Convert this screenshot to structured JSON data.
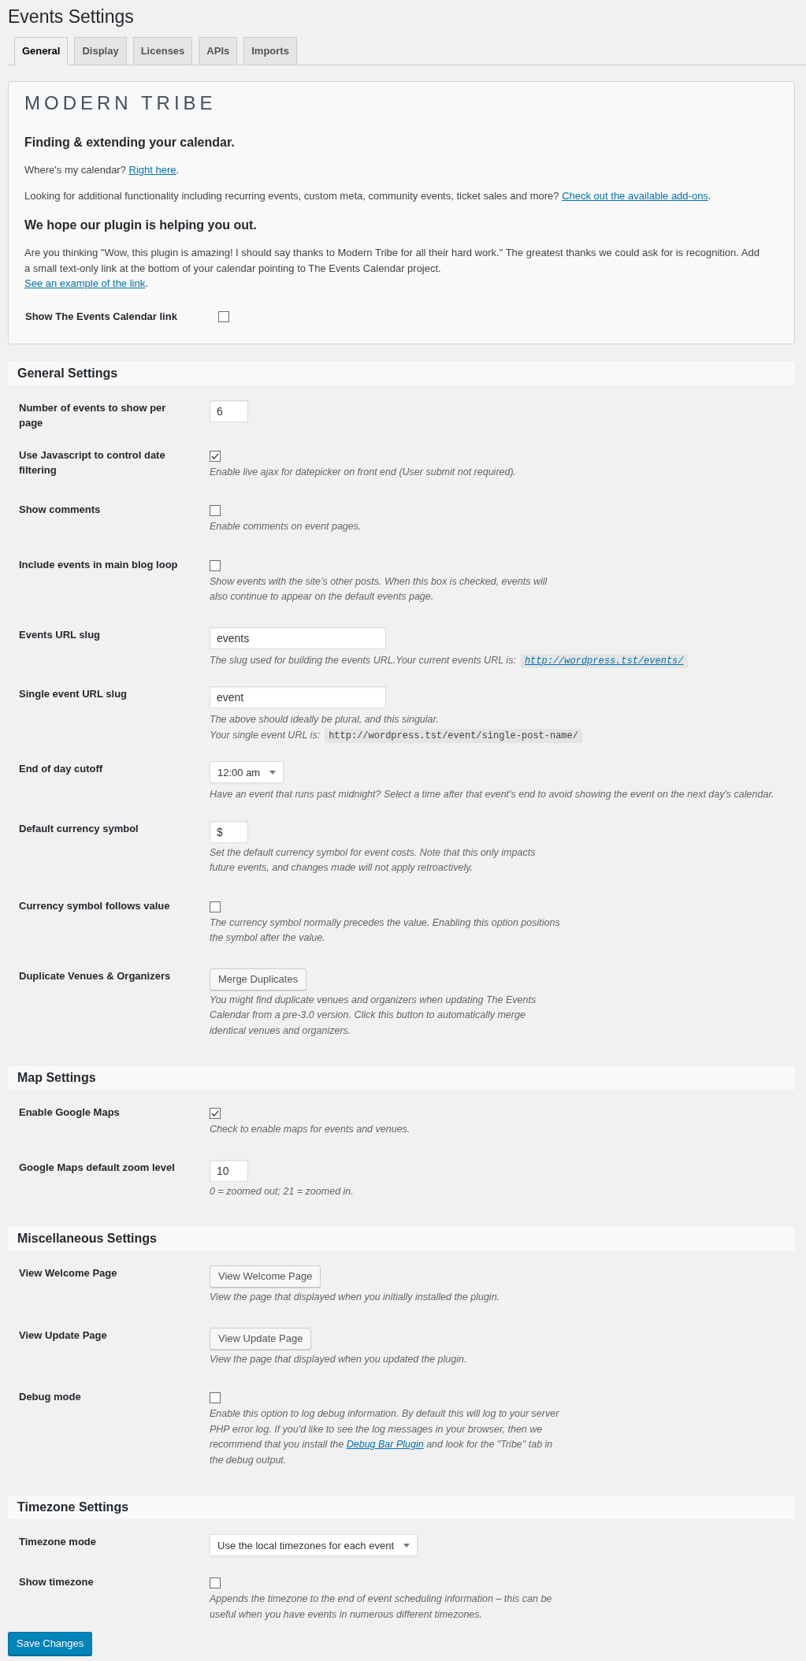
{
  "title": "Events Settings",
  "tabs": [
    {
      "label": "General",
      "selected": true
    },
    {
      "label": "Display",
      "selected": false
    },
    {
      "label": "Licenses",
      "selected": false
    },
    {
      "label": "APIs",
      "selected": false
    },
    {
      "label": "Imports",
      "selected": false
    }
  ],
  "welcome": {
    "logo": "MODERN TRIBE",
    "blocks": [
      {
        "kind": "heading",
        "text": "Finding & extending your calendar."
      },
      {
        "kind": "paragraph",
        "text": "Where's my calendar? ",
        "link": "Right here",
        "after": "."
      },
      {
        "kind": "paragraph",
        "text": "Looking for additional functionality including recurring events, custom meta, community events, ticket sales and more? ",
        "link": "Check out the available add-ons",
        "after": "."
      },
      {
        "kind": "heading",
        "text": "We hope our plugin is helping you out."
      },
      {
        "kind": "paragraph",
        "text": "Are you thinking \"Wow, this plugin is amazing! I should say thanks to Modern Tribe for all their hard work.\" The greatest thanks we could ask for is recognition. Add a small text-only link at the bottom of your calendar pointing to The Events Calendar project.",
        "link_line": {
          "link": "See an example of the link",
          "after": "."
        }
      }
    ],
    "field": {
      "label": "Show The Events Calendar link",
      "kind": "checkbox",
      "checked": false
    }
  },
  "sections": [
    {
      "title": "General Settings",
      "fields": [
        {
          "label": "Number of events to show per page",
          "kind": "short",
          "value": "6"
        },
        {
          "label": "Use Javascript to control date filtering",
          "kind": "checkbox",
          "checked": true,
          "description": "Enable live ajax for datepicker on front end (User submit not required)."
        },
        {
          "label": "Show comments",
          "kind": "checkbox",
          "checked": false,
          "description": "Enable comments on event pages."
        },
        {
          "label": "Include events in main blog loop",
          "kind": "checkbox",
          "checked": false,
          "description": "Show events with the site's other posts. When this box is checked, events will also continue to appear on the default events page."
        },
        {
          "label": "Events URL slug",
          "kind": "text",
          "value": "events",
          "url_label": "The slug used for building the events URL.Your current events URL is:",
          "url": {
            "text": "http://wordpress.tst/events/",
            "linked": true
          }
        },
        {
          "label": "Single event URL slug",
          "kind": "text",
          "value": "event",
          "description": "The above should ideally be plural, and this singular.",
          "url_label": "Your single event URL is:",
          "url": {
            "text": "http://wordpress.tst/event/single-post-name/",
            "linked": false
          }
        },
        {
          "label": "End of day cutoff",
          "kind": "select",
          "value": "12:00 am",
          "description": "Have an event that runs past midnight? Select a time after that event's end to avoid showing the event on the next day's calendar."
        },
        {
          "label": "Default currency symbol",
          "kind": "short",
          "value": "$",
          "description": "Set the default currency symbol for event costs. Note that this only impacts future events, and changes made will not apply retroactively."
        },
        {
          "label": "Currency symbol follows value",
          "kind": "checkbox",
          "checked": false,
          "description": "The currency symbol normally precedes the value. Enabling this option positions the symbol after the value."
        },
        {
          "label": "Duplicate Venues & Organizers",
          "kind": "button",
          "button": "Merge Duplicates",
          "description": "You might find duplicate venues and organizers when updating The Events Calendar from a pre-3.0 version. Click this button to automatically merge identical venues and organizers."
        }
      ]
    },
    {
      "title": "Map Settings",
      "fields": [
        {
          "label": "Enable Google Maps",
          "kind": "checkbox",
          "checked": true,
          "description": "Check to enable maps for events and venues."
        },
        {
          "label": "Google Maps default zoom level",
          "kind": "short",
          "value": "10",
          "description": "0 = zoomed out; 21 = zoomed in."
        }
      ]
    },
    {
      "title": "Miscellaneous Settings",
      "fields": [
        {
          "label": "View Welcome Page",
          "kind": "button",
          "button": "View Welcome Page",
          "description": "View the page that displayed when you initially installed the plugin."
        },
        {
          "label": "View Update Page",
          "kind": "button",
          "button": "View Update Page",
          "description": "View the page that displayed when you updated the plugin."
        },
        {
          "label": "Debug mode",
          "kind": "checkbox",
          "checked": false,
          "description": "Enable this option to log debug information. By default this will log to your server PHP error log. If you'd like to see the log messages in your browser, then we recommend that you install the ",
          "description_link": "Debug Bar Plugin",
          "description_after": " and look for the \"Tribe\" tab in the debug output."
        }
      ]
    },
    {
      "title": "Timezone Settings",
      "fields": [
        {
          "label": "Timezone mode",
          "kind": "select",
          "value": "Use the local timezones for each event"
        },
        {
          "label": "Show timezone",
          "kind": "checkbox",
          "checked": false,
          "description": "Appends the timezone to the end of event scheduling information – this can be useful when you have events in numerous different timezones."
        }
      ]
    }
  ],
  "submit": {
    "label": "Save Changes"
  }
}
